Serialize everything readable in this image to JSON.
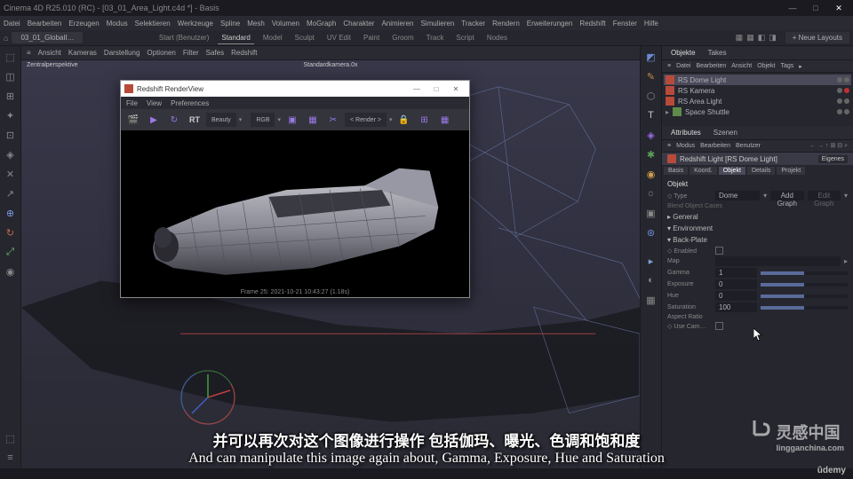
{
  "window": {
    "title": "Cinema 4D R25.010 (RC) - [03_01_Area_Light.c4d *] - Basis",
    "min": "—",
    "max": "□",
    "close": "✕"
  },
  "menu": [
    "Datei",
    "Bearbeiten",
    "Erzeugen",
    "Modus",
    "Selektieren",
    "Werkzeuge",
    "Spline",
    "Mesh",
    "Volumen",
    "MoGraph",
    "Charakter",
    "Animieren",
    "Simulieren",
    "Tracker",
    "Rendern",
    "Erweiterungen",
    "Redshift",
    "Fenster",
    "Hilfe"
  ],
  "tabs": {
    "file": "03_01_GlobalI…"
  },
  "topmodes": [
    "Start (Benutzer)",
    "Standard",
    "Model",
    "Sculpt",
    "UV Edit",
    "Paint",
    "Groom",
    "Track",
    "Script",
    "Nodes"
  ],
  "topmodes_active": 1,
  "topbtn": "+ Neue Layouts",
  "viewport": {
    "menu": [
      "≡",
      "Ansicht",
      "Kameras",
      "Darstellung",
      "Optionen",
      "Filter",
      "Safes",
      "Redshift"
    ],
    "label_persp": "Zentralperspektive",
    "label_cam": "Standardkamera.0x"
  },
  "objects_panel": {
    "tabs": [
      "Objekte",
      "Takes"
    ],
    "subtabs": [
      "≡",
      "Datei",
      "Bearbeiten",
      "Ansicht",
      "Objekt",
      "Tags",
      "▸"
    ],
    "items": [
      {
        "name": "RS Dome Light",
        "ico": "#b84a3a",
        "sel": true
      },
      {
        "name": "RS Kamera",
        "ico": "#b84a3a",
        "sel": false,
        "badge": "#c03030"
      },
      {
        "name": "RS Area Light",
        "ico": "#b84a3a",
        "sel": false
      },
      {
        "name": "Space Shuttle",
        "ico": "#608a4a",
        "sel": false
      }
    ]
  },
  "attrs": {
    "header": [
      "Attributes",
      "Szenen"
    ],
    "title": "Redshift Light [RS Dome Light]",
    "mode": "Eigenes",
    "tabs": [
      "Basis",
      "Koord.",
      "Objekt",
      "Details",
      "Projekt"
    ],
    "active_tab": 2,
    "object_label": "Objekt",
    "type_label": "◇ Type",
    "type_value": "Dome",
    "add_graph": "Add Graph",
    "edit_graph": "Edit Graph",
    "cycles": "Blend Object Cases",
    "sections": [
      "▸ General",
      "▾ Environment",
      "▾ Back-Plate"
    ],
    "rows": [
      {
        "label": "◇ Enabled",
        "val": ""
      },
      {
        "label": "Map",
        "val": ""
      },
      {
        "label": "Gamma",
        "val": "1"
      },
      {
        "label": "Exposure",
        "val": "0"
      },
      {
        "label": "Hue",
        "val": "0"
      },
      {
        "label": "Saturation",
        "val": "100"
      },
      {
        "label": "Aspect Ratio",
        "val": ""
      },
      {
        "label": "◇ Use Cam…",
        "val": ""
      }
    ]
  },
  "renderview": {
    "title": "Redshift RenderView",
    "menu": [
      "File",
      "View",
      "Preferences"
    ],
    "rt": "RT",
    "beauty": "Beauty",
    "rgb": "RGB",
    "render": "< Render >",
    "status": "Frame  25: 2021-10-21 10:43:27 (1.18s)"
  },
  "subtitle": {
    "cn": "并可以再次对这个图像进行操作 包括伽玛、曝光、色调和饱和度",
    "en": "And can manipulate this image again about, Gamma, Exposure, Hue and Saturation"
  },
  "watermark": {
    "main": "灵感中国",
    "sub": "lingganchina.com"
  },
  "brand": "ûdemy"
}
